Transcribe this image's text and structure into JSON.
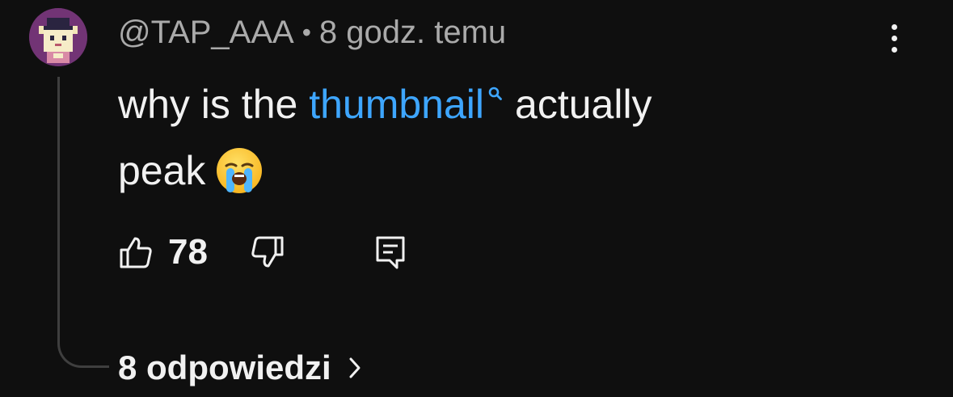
{
  "comment": {
    "author": "@TAP_AAA",
    "separator": "•",
    "timestamp": "8 godz. temu",
    "text_before": "why is the ",
    "link_text": "thumbnail",
    "text_after_line1": "actually",
    "text_line2": "peak",
    "emoji": "loudly-crying-face-emoji",
    "like_count": "78",
    "replies_label": "8 odpowiedzi"
  },
  "icons": {
    "menu": "more-vertical-icon",
    "like": "thumbs-up-icon",
    "dislike": "thumbs-down-icon",
    "reply": "reply-comment-icon",
    "search": "search-icon",
    "chevron": "chevron-right-icon"
  },
  "colors": {
    "background": "#0f0f0f",
    "text": "#f1f1f1",
    "meta_text": "#aaaaaa",
    "link": "#3ea6ff",
    "thread_line": "#3f3f3f",
    "avatar_bg": "#6b2f6e"
  }
}
